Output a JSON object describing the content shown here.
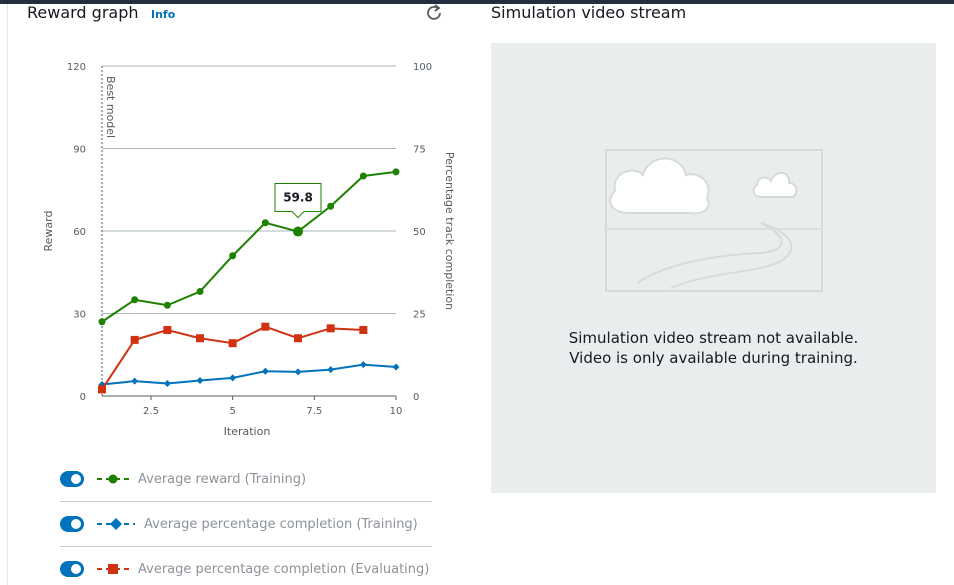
{
  "reward_panel": {
    "title": "Reward graph",
    "info_label": "Info"
  },
  "video_panel": {
    "title": "Simulation video stream",
    "message_line1": "Simulation video stream not available.",
    "message_line2": "Video is only available during training."
  },
  "chart_data": {
    "type": "line",
    "title": "",
    "xlabel": "Iteration",
    "ylabel": "Reward",
    "y2label": "Percentage track completion",
    "xlim": [
      1,
      10
    ],
    "ylim": [
      0,
      120
    ],
    "y2lim": [
      0,
      100
    ],
    "x_ticks": [
      "2.5",
      "5",
      "7.5",
      "10"
    ],
    "y_ticks": [
      "0",
      "30",
      "60",
      "90",
      "120"
    ],
    "y2_ticks": [
      "0",
      "25",
      "50",
      "75",
      "100"
    ],
    "grid": true,
    "annotations": [
      {
        "label": "Best model",
        "x": 1
      },
      {
        "label": "59.8",
        "x": 7,
        "y": 59.8
      }
    ],
    "series": [
      {
        "name": "Average reward (Training)",
        "axis": "left",
        "color": "#1d8102",
        "marker": "circle",
        "x": [
          1,
          2,
          3,
          4,
          5,
          6,
          7,
          8,
          9,
          10
        ],
        "y": [
          27,
          35,
          33,
          38,
          51,
          63,
          59.8,
          69,
          80,
          81.5
        ]
      },
      {
        "name": "Average percentage completion (Training)",
        "axis": "right",
        "color": "#0073bb",
        "marker": "diamond",
        "x": [
          1,
          2,
          3,
          4,
          5,
          6,
          7,
          8,
          9,
          10
        ],
        "y": [
          3.5,
          4.5,
          3.8,
          4.7,
          5.5,
          7.5,
          7.3,
          8,
          9.5,
          8.8
        ]
      },
      {
        "name": "Average percentage completion (Evaluating)",
        "axis": "right",
        "color": "#d13212",
        "marker": "square",
        "x": [
          1,
          2,
          3,
          4,
          5,
          6,
          7,
          8,
          9
        ],
        "y": [
          2,
          17,
          20,
          17.5,
          16,
          21,
          17.5,
          20.5,
          20
        ]
      }
    ]
  }
}
